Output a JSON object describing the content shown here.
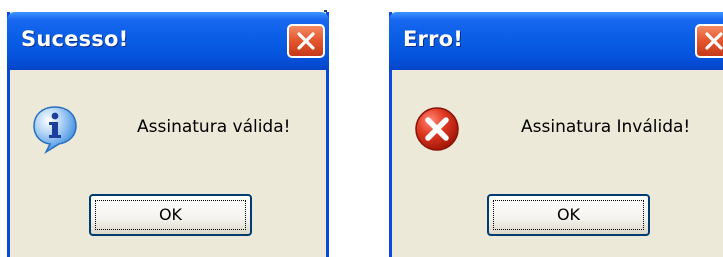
{
  "dialogs": [
    {
      "title": "Sucesso!",
      "icon": "info-icon",
      "message": "Assinatura válida!",
      "button_label": "OK"
    },
    {
      "title": "Erro!",
      "icon": "error-icon",
      "message": "Assinatura Inválida!",
      "button_label": "OK"
    }
  ],
  "colors": {
    "titlebar": "#0553dd",
    "window_bg": "#ece9d8",
    "close_button": "#e4552c",
    "info_icon": "#3f8fe0",
    "error_icon": "#d22a16"
  }
}
